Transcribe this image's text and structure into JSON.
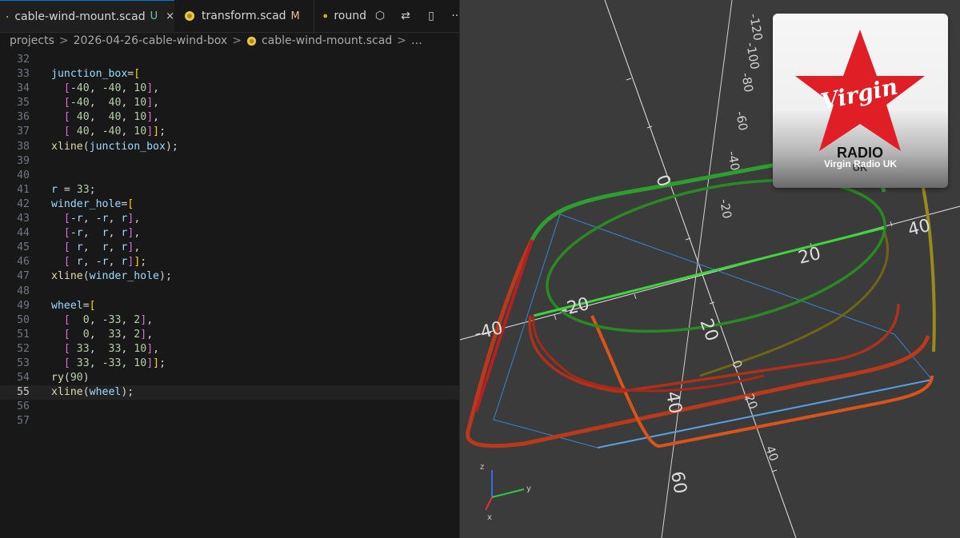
{
  "tabs": [
    {
      "label": "cable-wind-mount.scad",
      "status": "U",
      "close": "×"
    },
    {
      "label": "transform.scad",
      "status": "M"
    },
    {
      "label": "round"
    }
  ],
  "tab_actions": {
    "preview": "⬡",
    "compare": "⇄",
    "split": "▯",
    "more": "···"
  },
  "breadcrumb": {
    "items": [
      "projects",
      "2026-04-26-cable-wind-box",
      "cable-wind-mount.scad"
    ],
    "separator": ">",
    "ellipsis": "…"
  },
  "code": {
    "current_line": 55,
    "lines": [
      {
        "n": "32",
        "tokens": []
      },
      {
        "n": "33",
        "tokens": [
          [
            "ident",
            "junction_box"
          ],
          [
            "pl",
            "="
          ],
          [
            "br1",
            "["
          ]
        ]
      },
      {
        "n": "34",
        "tokens": [
          [
            "pl",
            "  "
          ],
          [
            "br2",
            "["
          ],
          [
            "pl",
            "-"
          ],
          [
            "num",
            "40"
          ],
          [
            "pl",
            ", -"
          ],
          [
            "num",
            "40"
          ],
          [
            "pl",
            ", "
          ],
          [
            "num",
            "10"
          ],
          [
            "br2",
            "]"
          ],
          [
            "pl",
            ","
          ]
        ]
      },
      {
        "n": "35",
        "tokens": [
          [
            "pl",
            "  "
          ],
          [
            "br2",
            "["
          ],
          [
            "pl",
            "-"
          ],
          [
            "num",
            "40"
          ],
          [
            "pl",
            ",  "
          ],
          [
            "num",
            "40"
          ],
          [
            "pl",
            ", "
          ],
          [
            "num",
            "10"
          ],
          [
            "br2",
            "]"
          ],
          [
            "pl",
            ","
          ]
        ]
      },
      {
        "n": "36",
        "tokens": [
          [
            "pl",
            "  "
          ],
          [
            "br2",
            "["
          ],
          [
            "pl",
            " "
          ],
          [
            "num",
            "40"
          ],
          [
            "pl",
            ",  "
          ],
          [
            "num",
            "40"
          ],
          [
            "pl",
            ", "
          ],
          [
            "num",
            "10"
          ],
          [
            "br2",
            "]"
          ],
          [
            "pl",
            ","
          ]
        ]
      },
      {
        "n": "37",
        "tokens": [
          [
            "pl",
            "  "
          ],
          [
            "br2",
            "["
          ],
          [
            "pl",
            " "
          ],
          [
            "num",
            "40"
          ],
          [
            "pl",
            ", -"
          ],
          [
            "num",
            "40"
          ],
          [
            "pl",
            ", "
          ],
          [
            "num",
            "10"
          ],
          [
            "br2",
            "]"
          ],
          [
            "br1",
            "]"
          ],
          [
            "pl",
            ";"
          ]
        ]
      },
      {
        "n": "38",
        "tokens": [
          [
            "fn",
            "xline"
          ],
          [
            "pl",
            "("
          ],
          [
            "ident",
            "junction_box"
          ],
          [
            "pl",
            ");"
          ]
        ]
      },
      {
        "n": "39",
        "tokens": []
      },
      {
        "n": "40",
        "tokens": []
      },
      {
        "n": "41",
        "tokens": [
          [
            "ident",
            "r"
          ],
          [
            "pl",
            " = "
          ],
          [
            "num",
            "33"
          ],
          [
            "pl",
            ";"
          ]
        ]
      },
      {
        "n": "42",
        "tokens": [
          [
            "ident",
            "winder_hole"
          ],
          [
            "pl",
            "="
          ],
          [
            "br1",
            "["
          ]
        ]
      },
      {
        "n": "43",
        "tokens": [
          [
            "pl",
            "  "
          ],
          [
            "br2",
            "["
          ],
          [
            "pl",
            "-"
          ],
          [
            "ident",
            "r"
          ],
          [
            "pl",
            ", -"
          ],
          [
            "ident",
            "r"
          ],
          [
            "pl",
            ", "
          ],
          [
            "ident",
            "r"
          ],
          [
            "br2",
            "]"
          ],
          [
            "pl",
            ","
          ]
        ]
      },
      {
        "n": "44",
        "tokens": [
          [
            "pl",
            "  "
          ],
          [
            "br2",
            "["
          ],
          [
            "pl",
            "-"
          ],
          [
            "ident",
            "r"
          ],
          [
            "pl",
            ",  "
          ],
          [
            "ident",
            "r"
          ],
          [
            "pl",
            ", "
          ],
          [
            "ident",
            "r"
          ],
          [
            "br2",
            "]"
          ],
          [
            "pl",
            ","
          ]
        ]
      },
      {
        "n": "45",
        "tokens": [
          [
            "pl",
            "  "
          ],
          [
            "br2",
            "["
          ],
          [
            "pl",
            " "
          ],
          [
            "ident",
            "r"
          ],
          [
            "pl",
            ",  "
          ],
          [
            "ident",
            "r"
          ],
          [
            "pl",
            ", "
          ],
          [
            "ident",
            "r"
          ],
          [
            "br2",
            "]"
          ],
          [
            "pl",
            ","
          ]
        ]
      },
      {
        "n": "46",
        "tokens": [
          [
            "pl",
            "  "
          ],
          [
            "br2",
            "["
          ],
          [
            "pl",
            " "
          ],
          [
            "ident",
            "r"
          ],
          [
            "pl",
            ", -"
          ],
          [
            "ident",
            "r"
          ],
          [
            "pl",
            ", "
          ],
          [
            "ident",
            "r"
          ],
          [
            "br2",
            "]"
          ],
          [
            "br1",
            "]"
          ],
          [
            "pl",
            ";"
          ]
        ]
      },
      {
        "n": "47",
        "tokens": [
          [
            "fn",
            "xline"
          ],
          [
            "pl",
            "("
          ],
          [
            "ident",
            "winder_hole"
          ],
          [
            "pl",
            ");"
          ]
        ]
      },
      {
        "n": "48",
        "tokens": []
      },
      {
        "n": "49",
        "tokens": [
          [
            "ident",
            "wheel"
          ],
          [
            "pl",
            "="
          ],
          [
            "br1",
            "["
          ]
        ]
      },
      {
        "n": "50",
        "tokens": [
          [
            "pl",
            "  "
          ],
          [
            "br2",
            "["
          ],
          [
            "pl",
            "  "
          ],
          [
            "num",
            "0"
          ],
          [
            "pl",
            ", -"
          ],
          [
            "num",
            "33"
          ],
          [
            "pl",
            ", "
          ],
          [
            "num",
            "2"
          ],
          [
            "br2",
            "]"
          ],
          [
            "pl",
            ","
          ]
        ]
      },
      {
        "n": "51",
        "tokens": [
          [
            "pl",
            "  "
          ],
          [
            "br2",
            "["
          ],
          [
            "pl",
            "  "
          ],
          [
            "num",
            "0"
          ],
          [
            "pl",
            ",  "
          ],
          [
            "num",
            "33"
          ],
          [
            "pl",
            ", "
          ],
          [
            "num",
            "2"
          ],
          [
            "br2",
            "]"
          ],
          [
            "pl",
            ","
          ]
        ]
      },
      {
        "n": "52",
        "tokens": [
          [
            "pl",
            "  "
          ],
          [
            "br2",
            "["
          ],
          [
            "pl",
            " "
          ],
          [
            "num",
            "33"
          ],
          [
            "pl",
            ",  "
          ],
          [
            "num",
            "33"
          ],
          [
            "pl",
            ", "
          ],
          [
            "num",
            "10"
          ],
          [
            "br2",
            "]"
          ],
          [
            "pl",
            ","
          ]
        ]
      },
      {
        "n": "53",
        "tokens": [
          [
            "pl",
            "  "
          ],
          [
            "br2",
            "["
          ],
          [
            "pl",
            " "
          ],
          [
            "num",
            "33"
          ],
          [
            "pl",
            ", -"
          ],
          [
            "num",
            "33"
          ],
          [
            "pl",
            ", "
          ],
          [
            "num",
            "10"
          ],
          [
            "br2",
            "]"
          ],
          [
            "br1",
            "]"
          ],
          [
            "pl",
            ";"
          ]
        ]
      },
      {
        "n": "54",
        "tokens": [
          [
            "fn",
            "ry"
          ],
          [
            "pl",
            "("
          ],
          [
            "num",
            "90"
          ],
          [
            "pl",
            ")"
          ]
        ]
      },
      {
        "n": "55",
        "tokens": [
          [
            "fn",
            "xline"
          ],
          [
            "pl",
            "("
          ],
          [
            "ident",
            "wheel"
          ],
          [
            "pl",
            ");"
          ]
        ]
      },
      {
        "n": "56",
        "tokens": []
      },
      {
        "n": "57",
        "tokens": []
      }
    ]
  },
  "viewport": {
    "axis_labels": {
      "x_neg40": "-40",
      "x_neg20": "-20",
      "x_20": "20",
      "x_40": "40",
      "y_0": "0",
      "y_20": "20",
      "y_40": "40",
      "y_60": "60",
      "z_neg20": "-20",
      "z_neg40": "-40",
      "z_neg60": "-60",
      "z_neg80": "-80",
      "z_neg100": "-100",
      "z_neg120": "-120",
      "small_0": "0",
      "small_20": "20",
      "small_40": "40"
    },
    "gizmo": {
      "x": "x",
      "y": "y",
      "z": "z"
    },
    "colors": {
      "background": "#3b3b3b",
      "red": "#c0392b",
      "green": "#2ecc40",
      "orange": "#e25a12",
      "olive": "#8a7a18",
      "blue": "#3a7fc2"
    }
  },
  "overlay": {
    "logo_word": "Virgin",
    "logo_radio": "RADIO",
    "logo_uk": "UK",
    "caption": "Virgin Radio UK"
  }
}
